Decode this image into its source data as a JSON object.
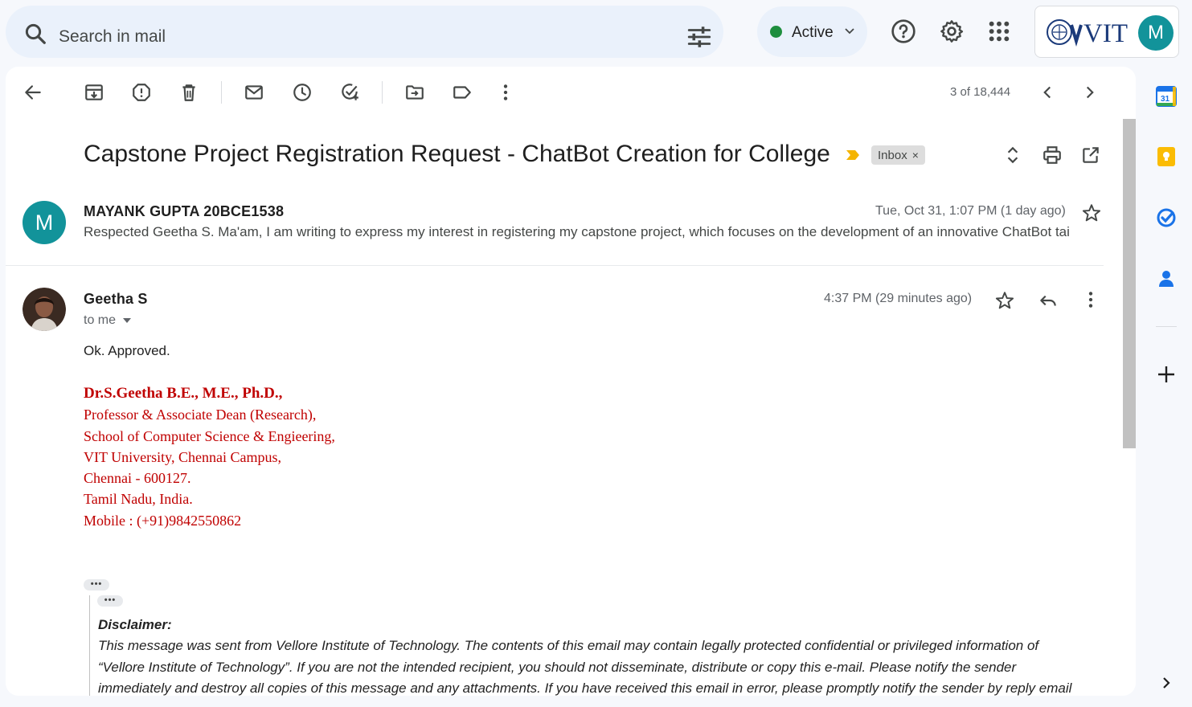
{
  "search": {
    "placeholder": "Search in mail"
  },
  "status": {
    "label": "Active",
    "color": "#1e8e3e"
  },
  "brand": {
    "logo_text": "VIT",
    "avatar_letter": "M"
  },
  "pagination": {
    "text": "3 of 18,444"
  },
  "email": {
    "subject": "Capstone Project Registration Request - ChatBot Creation for College",
    "label_chip": "Inbox",
    "chip_close": "×",
    "messages": [
      {
        "sender": "MAYANK GUPTA 20BCE1538",
        "avatar_letter": "M",
        "date": "Tue, Oct 31, 1:07 PM (1 day ago)",
        "snippet": "Respected Geetha S. Ma'am, I am writing to express my interest in registering my capstone project, which focuses on the development of an innovative ChatBot tai"
      },
      {
        "sender": "Geetha S",
        "recipient": "to me",
        "date": "4:37 PM (29 minutes ago)",
        "body": "Ok. Approved.",
        "signature": [
          "Dr.S.Geetha B.E., M.E., Ph.D.,",
          "Professor & Associate Dean (Research),",
          "School of Computer Science & Engieering,",
          "VIT University, Chennai Campus,",
          "Chennai - 600127.",
          "Tamil Nadu, India.",
          "Mobile : (+91)9842550862"
        ],
        "trimmed_indicator": "•••",
        "disclaimer": {
          "heading": "Disclaimer:",
          "lines": [
            "This message was sent from Vellore Institute of Technology.  The contents of this email may contain legally protected confidential or privileged information of",
            "“Vellore Institute of Technology”.  If you are not the intended recipient, you should not disseminate, distribute or copy this e-mail. Please notify the sender",
            "immediately and destroy all copies of this message and any attachments. If you have received this email in error, please promptly notify the sender by reply email"
          ]
        }
      }
    ]
  },
  "side_panel": {
    "calendar_day": "31"
  },
  "colors": {
    "signature": "#c00000",
    "accent_blue": "#1a73e8",
    "avatar_teal": "#12939a",
    "important_marker": "#f4b400"
  }
}
